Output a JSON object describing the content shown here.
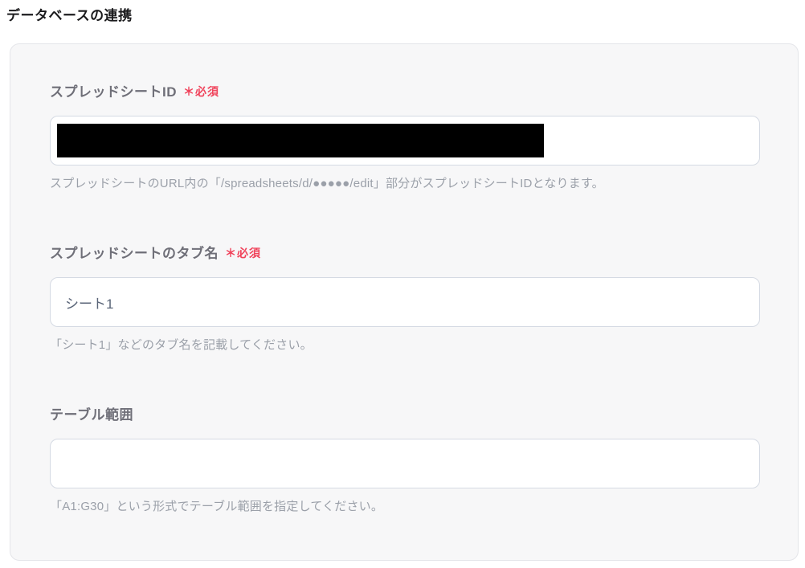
{
  "page": {
    "title": "データベースの連携"
  },
  "colors": {
    "required_badge": "#f0435b",
    "card_background": "#f7f7f8",
    "card_border": "#e4e5e9",
    "input_border": "#d5dae3",
    "label_text": "#6f6f78",
    "help_text": "#9ba0a9",
    "input_text": "#5a6578",
    "redaction": "#000000"
  },
  "form": {
    "fields": [
      {
        "label": "スプレッドシートID",
        "required_label": "＊必須",
        "value": "",
        "redacted": true,
        "help": "スプレッドシートのURL内の「/spreadsheets/d/●●●●●/edit」部分がスプレッドシートIDとなります。"
      },
      {
        "label": "スプレッドシートのタブ名",
        "required_label": "＊必須",
        "value": "シート1",
        "redacted": false,
        "help": "「シート1」などのタブ名を記載してください。"
      },
      {
        "label": "テーブル範囲",
        "value": "",
        "redacted": false,
        "help": "「A1:G30」という形式でテーブル範囲を指定してください。"
      }
    ]
  }
}
